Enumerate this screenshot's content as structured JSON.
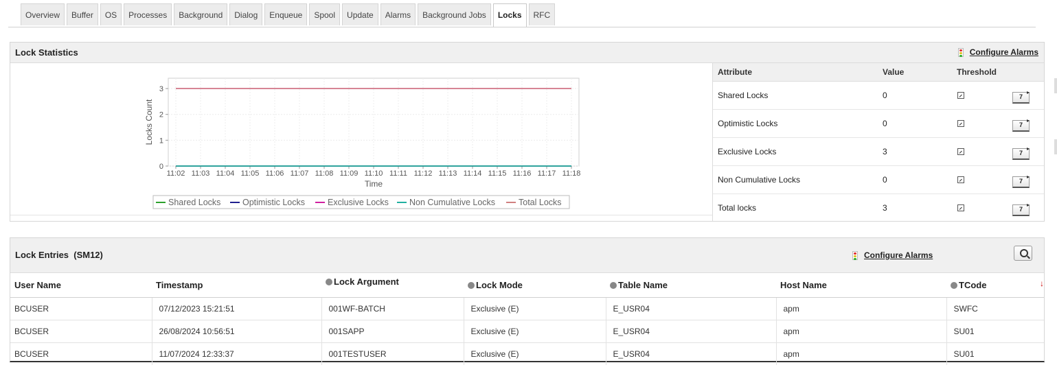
{
  "tabs": [
    "Overview",
    "Buffer",
    "OS",
    "Processes",
    "Background",
    "Dialog",
    "Enqueue",
    "Spool",
    "Update",
    "Alarms",
    "Background Jobs",
    "Locks",
    "RFC"
  ],
  "active_tab": "Locks",
  "lock_statistics": {
    "title": "Lock Statistics",
    "configure_alarms": "Configure Alarms",
    "attributes": {
      "headers": {
        "attribute": "Attribute",
        "value": "Value",
        "threshold": "Threshold"
      },
      "rows": [
        {
          "attribute": "Shared Locks",
          "value": "0",
          "threshold_btn": "7"
        },
        {
          "attribute": "Optimistic Locks",
          "value": "0",
          "threshold_btn": "7"
        },
        {
          "attribute": "Exclusive Locks",
          "value": "3",
          "threshold_btn": "7"
        },
        {
          "attribute": "Non Cumulative Locks",
          "value": "0",
          "threshold_btn": "7"
        },
        {
          "attribute": "Total locks",
          "value": "3",
          "threshold_btn": "7"
        }
      ]
    }
  },
  "chart_data": {
    "type": "line",
    "title": "",
    "xlabel": "Time",
    "ylabel": "Locks Count",
    "x": [
      "11:02",
      "11:03",
      "11:04",
      "11:05",
      "11:06",
      "11:07",
      "11:08",
      "11:09",
      "11:10",
      "11:11",
      "11:12",
      "11:13",
      "11:14",
      "11:15",
      "11:16",
      "11:17",
      "11:18"
    ],
    "yticks": [
      0,
      1,
      2,
      3
    ],
    "ylim": [
      0,
      3.4
    ],
    "grid": true,
    "legend_position": "bottom",
    "series": [
      {
        "name": "Shared Locks",
        "color": "#2ca02c",
        "values": [
          0,
          0,
          0,
          0,
          0,
          0,
          0,
          0,
          0,
          0,
          0,
          0,
          0,
          0,
          0,
          0,
          0
        ]
      },
      {
        "name": "Optimistic Locks",
        "color": "#1f1f8f",
        "values": [
          0,
          0,
          0,
          0,
          0,
          0,
          0,
          0,
          0,
          0,
          0,
          0,
          0,
          0,
          0,
          0,
          0
        ]
      },
      {
        "name": "Exclusive Locks",
        "color": "#d020a0",
        "values": [
          3,
          3,
          3,
          3,
          3,
          3,
          3,
          3,
          3,
          3,
          3,
          3,
          3,
          3,
          3,
          3,
          3
        ]
      },
      {
        "name": "Non Cumulative Locks",
        "color": "#20b0a0",
        "values": [
          0,
          0,
          0,
          0,
          0,
          0,
          0,
          0,
          0,
          0,
          0,
          0,
          0,
          0,
          0,
          0,
          0
        ]
      },
      {
        "name": "Total Locks",
        "color": "#d08080",
        "values": [
          3,
          3,
          3,
          3,
          3,
          3,
          3,
          3,
          3,
          3,
          3,
          3,
          3,
          3,
          3,
          3,
          3
        ]
      }
    ]
  },
  "lock_entries": {
    "title": "Lock Entries  (SM12)",
    "configure_alarms": "Configure Alarms",
    "headers": [
      "User Name",
      "Timestamp",
      "Lock Argument",
      "Lock Mode",
      "Table Name",
      "Host Name",
      "TCode"
    ],
    "rows": [
      [
        "BCUSER",
        "07/12/2023 15:21:51",
        "001WF-BATCH",
        "Exclusive (E)",
        "E_USR04",
        "apm",
        "SWFC"
      ],
      [
        "BCUSER",
        "26/08/2024 10:56:51",
        "001SAPP",
        "Exclusive (E)",
        "E_USR04",
        "apm",
        "SU01"
      ],
      [
        "BCUSER",
        "11/07/2024 12:33:37",
        "001TESTUSER",
        "Exclusive (E)",
        "E_USR04",
        "apm",
        "SU01"
      ]
    ]
  }
}
